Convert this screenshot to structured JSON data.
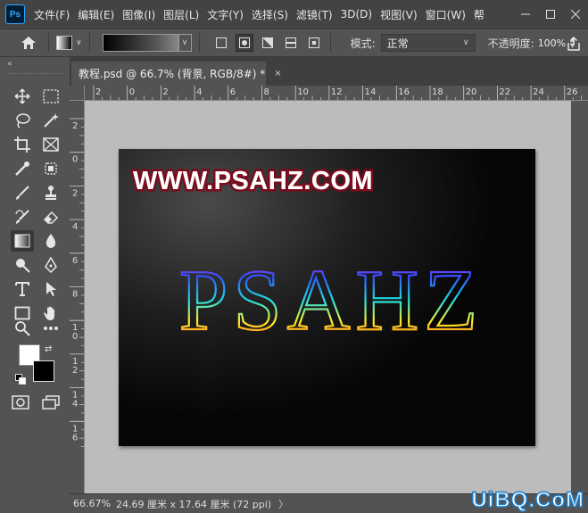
{
  "app": {
    "logo_text": "Ps"
  },
  "menu": [
    "文件(F)",
    "编辑(E)",
    "图像(I)",
    "图层(L)",
    "文字(Y)",
    "选择(S)",
    "滤镜(T)",
    "3D(D)",
    "视图(V)",
    "窗口(W)",
    "帮"
  ],
  "options": {
    "mode_label": "模式:",
    "mode_value": "正常",
    "opacity_label": "不透明度:",
    "opacity_value": "100%"
  },
  "document_tab": {
    "title": "教程.psd @ 66.7% (背景, RGB/8#) *",
    "close": "×"
  },
  "ruler_top_labels": [
    "2",
    "0",
    "2",
    "4",
    "6",
    "8",
    "10",
    "12",
    "14",
    "16",
    "18",
    "20",
    "22",
    "24",
    "26"
  ],
  "ruler_left_labels": [
    "2",
    "0",
    "2",
    "4",
    "6",
    "8",
    "1\n0",
    "1\n2",
    "1\n4",
    "1\n6"
  ],
  "canvas": {
    "top_text": "WWW.PSAHZ.COM",
    "neon_text": "PSAHZ"
  },
  "status": {
    "zoom": "66.67%",
    "doc_size": "24.69 厘米 x 17.64 厘米 (72 ppi)",
    "caret": "〉"
  },
  "watermark": "UiBQ.CoM",
  "colors": {
    "foreground": "#ffffff",
    "background": "#000000"
  }
}
